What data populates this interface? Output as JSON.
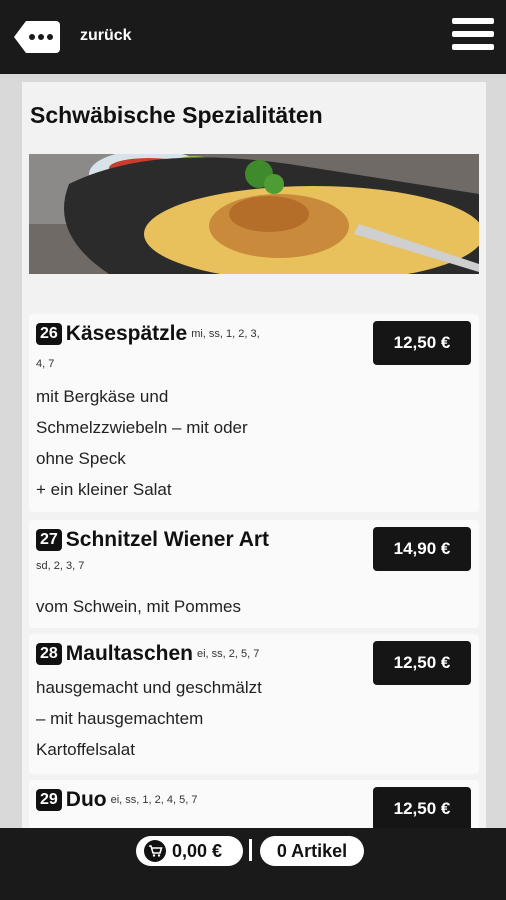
{
  "header": {
    "back_label": "zurück"
  },
  "page": {
    "title": "Schwäbische Spezialitäten"
  },
  "items": [
    {
      "number": "26",
      "name": "Käsespätzle",
      "allergens": "mi, ss, 1, 2, 3,",
      "allergens_cont": "4, 7",
      "desc_lines": [
        "mit Bergkäse und",
        "Schmelzzwiebeln – mit oder",
        "ohne Speck",
        "+ ein kleiner Salat"
      ],
      "price": "12,50 €"
    },
    {
      "number": "27",
      "name": "Schnitzel Wiener Art",
      "allergens": "sd, 2, 3, 7",
      "desc_lines": [
        "vom Schwein, mit Pommes"
      ],
      "price": "14,90 €"
    },
    {
      "number": "28",
      "name": "Maultaschen",
      "allergens": "ei, ss, 2, 5, 7",
      "desc_lines": [
        "hausgemacht und geschmälzt",
        "– mit hausgemachtem",
        "Kartoffelsalat"
      ],
      "price": "12,50 €"
    },
    {
      "number": "29",
      "name": "Duo",
      "allergens": "ei, ss, 1, 2, 4, 5, 7",
      "price": "12,50 €"
    }
  ],
  "cart": {
    "total": "0,00 €",
    "count": "0 Artikel"
  },
  "colors": {
    "bar": "#1a1a1a",
    "price_bg": "#151515",
    "card_bg": "#fafafa",
    "page_bg": "#f2f2f2"
  }
}
